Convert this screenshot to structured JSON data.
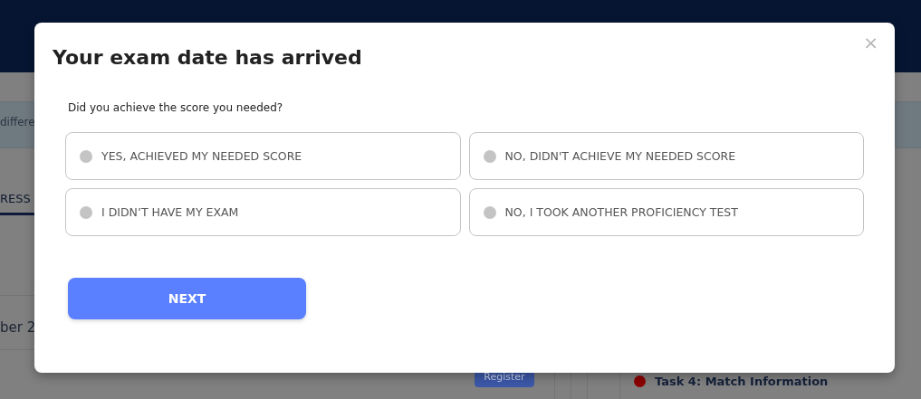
{
  "background": {
    "banner_text": "differe",
    "tab": "RESS",
    "row_text": "ber 2",
    "register_button": "Register",
    "task": {
      "label": "Task 4: Match Information",
      "color": "#8b0000"
    }
  },
  "dialog": {
    "title": "Your exam date has arrived",
    "question": "Did you achieve the score you needed?",
    "options": [
      {
        "label": "YES, ACHIEVED MY NEEDED SCORE",
        "selected": false
      },
      {
        "label": "NO, DIDN'T ACHIEVE MY NEEDED SCORE",
        "selected": false
      },
      {
        "label": "I DIDN’T HAVE MY EXAM",
        "selected": false
      },
      {
        "label": "NO, I TOOK ANOTHER PROFICIENCY TEST",
        "selected": false
      }
    ],
    "close": "×",
    "next_button": "NEXT"
  }
}
